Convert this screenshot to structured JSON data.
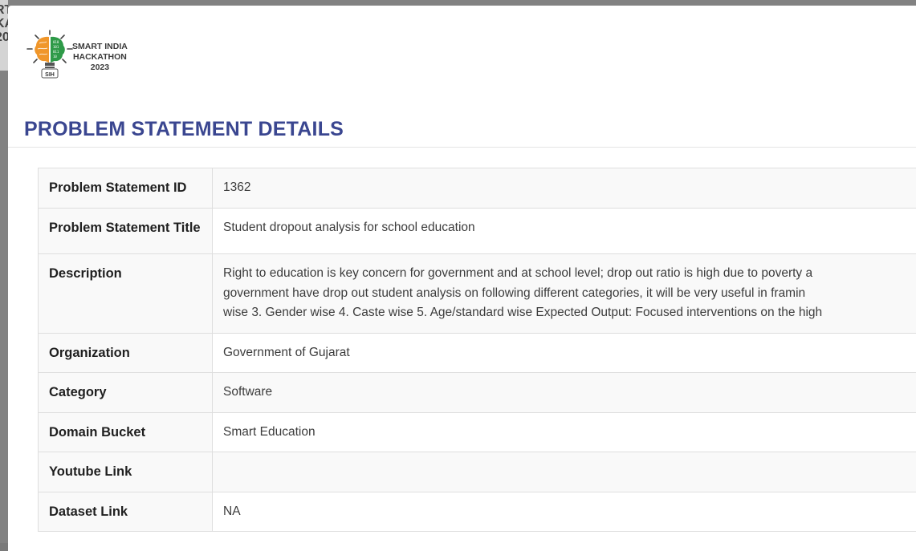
{
  "backdrop": {
    "partial_text": "RT\nKA\n20"
  },
  "header": {
    "logo": {
      "line1": "SMART INDIA",
      "line2": "HACKATHON",
      "line3": "2023",
      "badge": "SIH",
      "colors": {
        "orange": "#f0962a",
        "green": "#2e9a48"
      }
    },
    "title": "PROBLEM STATEMENT DETAILS",
    "title_color": "#3a4690"
  },
  "details": {
    "id_label": "Problem Statement ID",
    "id_value": "1362",
    "title_label": "Problem Statement Title",
    "title_value": "Student dropout analysis for school education",
    "description_label": "Description",
    "description_lines": [
      "Right to education is key concern for government and at school level; drop out ratio is high due to poverty a",
      "government have drop out student analysis on following different categories, it will be very useful in framin",
      "wise 3. Gender wise 4. Caste wise 5. Age/standard wise Expected Output: Focused interventions on the high"
    ],
    "organization_label": "Organization",
    "organization_value": "Government of Gujarat",
    "category_label": "Category",
    "category_value": "Software",
    "domain_label": "Domain Bucket",
    "domain_value": "Smart Education",
    "youtube_label": "Youtube Link",
    "youtube_value": "",
    "dataset_label": "Dataset Link",
    "dataset_value": "NA"
  }
}
